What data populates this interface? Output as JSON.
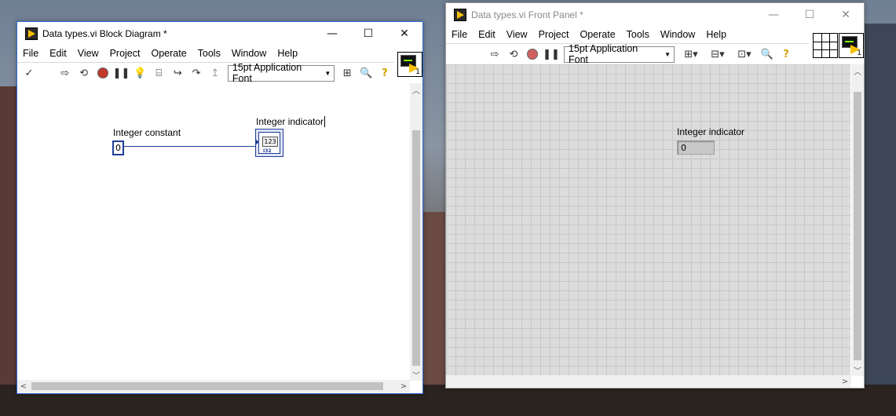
{
  "block_diagram": {
    "title": "Data types.vi Block Diagram *",
    "menus": [
      "File",
      "Edit",
      "View",
      "Project",
      "Operate",
      "Tools",
      "Window",
      "Help"
    ],
    "font": "15pt Application Font",
    "const_label": "Integer constant",
    "const_value": "0",
    "ind_label": "Integer indicator",
    "ind_glyph": "123",
    "ind_type": "I32",
    "icon_num": "1"
  },
  "front_panel": {
    "title": "Data types.vi Front Panel *",
    "menus": [
      "File",
      "Edit",
      "View",
      "Project",
      "Operate",
      "Tools",
      "Window",
      "Help"
    ],
    "font": "15pt Application Font",
    "ind_label": "Integer indicator",
    "ind_value": "0",
    "icon_num": "1"
  },
  "colors": {
    "accent": "#2e6bd4",
    "wire": "#1f3f99",
    "grid_bg": "#dcdcdc",
    "grid_line": "#c8c8c8"
  }
}
